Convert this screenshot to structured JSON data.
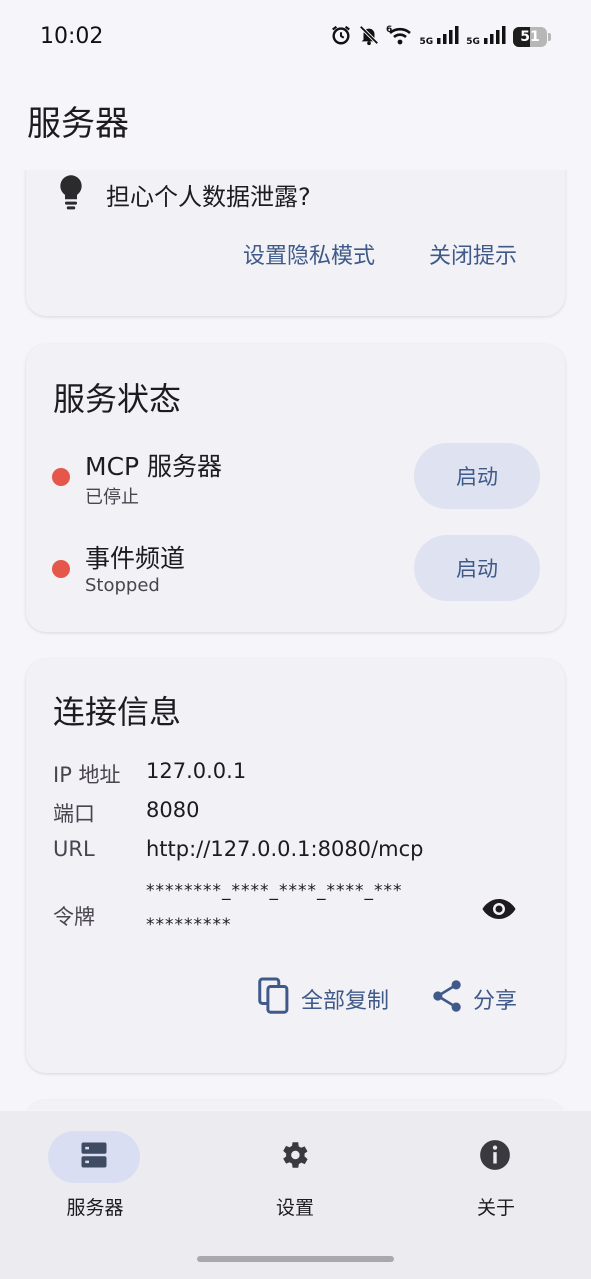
{
  "status_bar": {
    "time": "10:02",
    "icons": [
      "alarm-icon",
      "bell-off-icon",
      "wifi-icon",
      "signal-5g-icon",
      "signal-5g-icon",
      "battery-icon"
    ],
    "signal_label_1": "5G",
    "signal_label_2": "5G",
    "battery_level": "51",
    "wifi_label": "6"
  },
  "header": {
    "title": "服务器"
  },
  "privacy_tip": {
    "icon": "lightbulb-icon",
    "text": "担心个人数据泄露?",
    "primary_action": "设置隐私模式",
    "dismiss_action": "关闭提示"
  },
  "service_status": {
    "title": "服务状态",
    "status_color": "#e4574a",
    "items": [
      {
        "name": "MCP 服务器",
        "state": "已停止",
        "action": "启动"
      },
      {
        "name": "事件频道",
        "state": "Stopped",
        "action": "启动"
      }
    ]
  },
  "connection": {
    "title": "连接信息",
    "rows": [
      {
        "label": "IP 地址",
        "value": "127.0.0.1"
      },
      {
        "label": "端口",
        "value": "8080"
      },
      {
        "label": "URL",
        "value": "http://127.0.0.1:8080/mcp"
      }
    ],
    "token_label": "令牌",
    "token_line1": "********_****_****_****_***",
    "token_line2": "*********",
    "visibility_icon": "eye-icon",
    "copy_all": "全部复制",
    "share": "分享"
  },
  "bottom_nav": {
    "items": [
      {
        "label": "服务器",
        "icon": "server-icon",
        "active": true
      },
      {
        "label": "设置",
        "icon": "gear-icon",
        "active": false
      },
      {
        "label": "关于",
        "icon": "info-icon",
        "active": false
      }
    ]
  },
  "colors": {
    "accent": "#3f5a89",
    "background": "#f6f5fa",
    "card": "#f1f1f6",
    "button_tonal": "#dfe2f0",
    "nav_active": "#d9def3"
  }
}
